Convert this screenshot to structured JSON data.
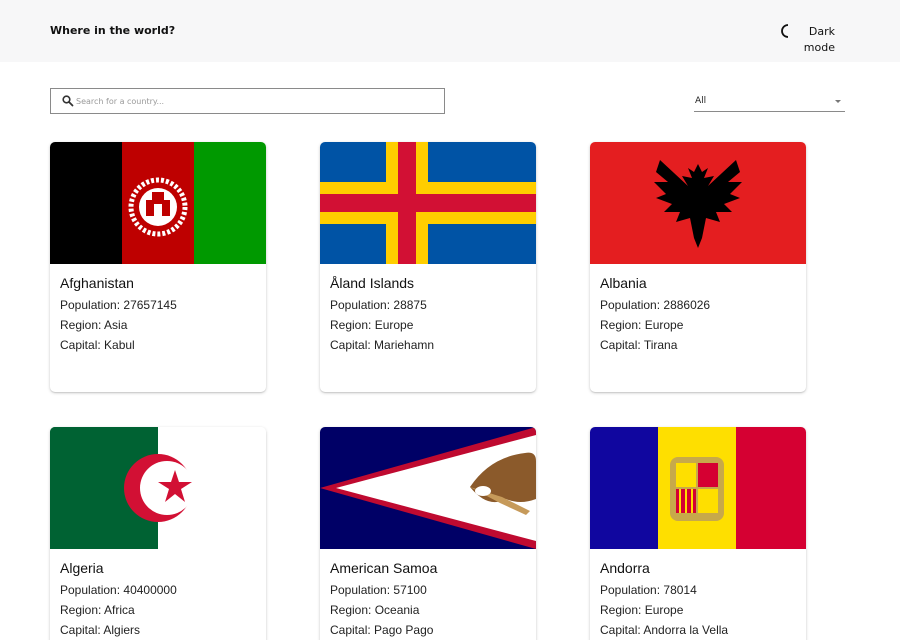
{
  "header": {
    "title": "Where in the world?",
    "mode_toggle": {
      "line1": "Dark",
      "line2": "mode",
      "icon": "moon-icon"
    }
  },
  "search": {
    "placeholder": "Search for a country...",
    "value": "",
    "icon": "search-icon"
  },
  "filter": {
    "selected": "All",
    "icon": "chevron-down-icon"
  },
  "labels": {
    "population": "Population: ",
    "region": "Region: ",
    "capital": "Capital: "
  },
  "countries": [
    {
      "name": "Afghanistan",
      "population": "27657145",
      "region": "Asia",
      "capital": "Kabul",
      "flag": "afghanistan-flag",
      "colors": [
        "#000000",
        "#be0000",
        "#009900"
      ]
    },
    {
      "name": "Åland Islands",
      "population": "28875",
      "region": "Europe",
      "capital": "Mariehamn",
      "flag": "aland-flag",
      "colors": [
        "#0053a5",
        "#ffce00",
        "#d21034"
      ]
    },
    {
      "name": "Albania",
      "population": "2886026",
      "region": "Europe",
      "capital": "Tirana",
      "flag": "albania-flag",
      "colors": [
        "#e41e20",
        "#000000"
      ]
    },
    {
      "name": "Algeria",
      "population": "40400000",
      "region": "Africa",
      "capital": "Algiers",
      "flag": "algeria-flag",
      "colors": [
        "#006233",
        "#ffffff",
        "#d21034"
      ]
    },
    {
      "name": "American Samoa",
      "population": "57100",
      "region": "Oceania",
      "capital": "Pago Pago",
      "flag": "american-samoa-flag",
      "colors": [
        "#000066",
        "#ffffff",
        "#bf0a30"
      ]
    },
    {
      "name": "Andorra",
      "population": "78014",
      "region": "Europe",
      "capital": "Andorra la Vella",
      "flag": "andorra-flag",
      "colors": [
        "#10069f",
        "#fedf00",
        "#d50032"
      ]
    }
  ]
}
